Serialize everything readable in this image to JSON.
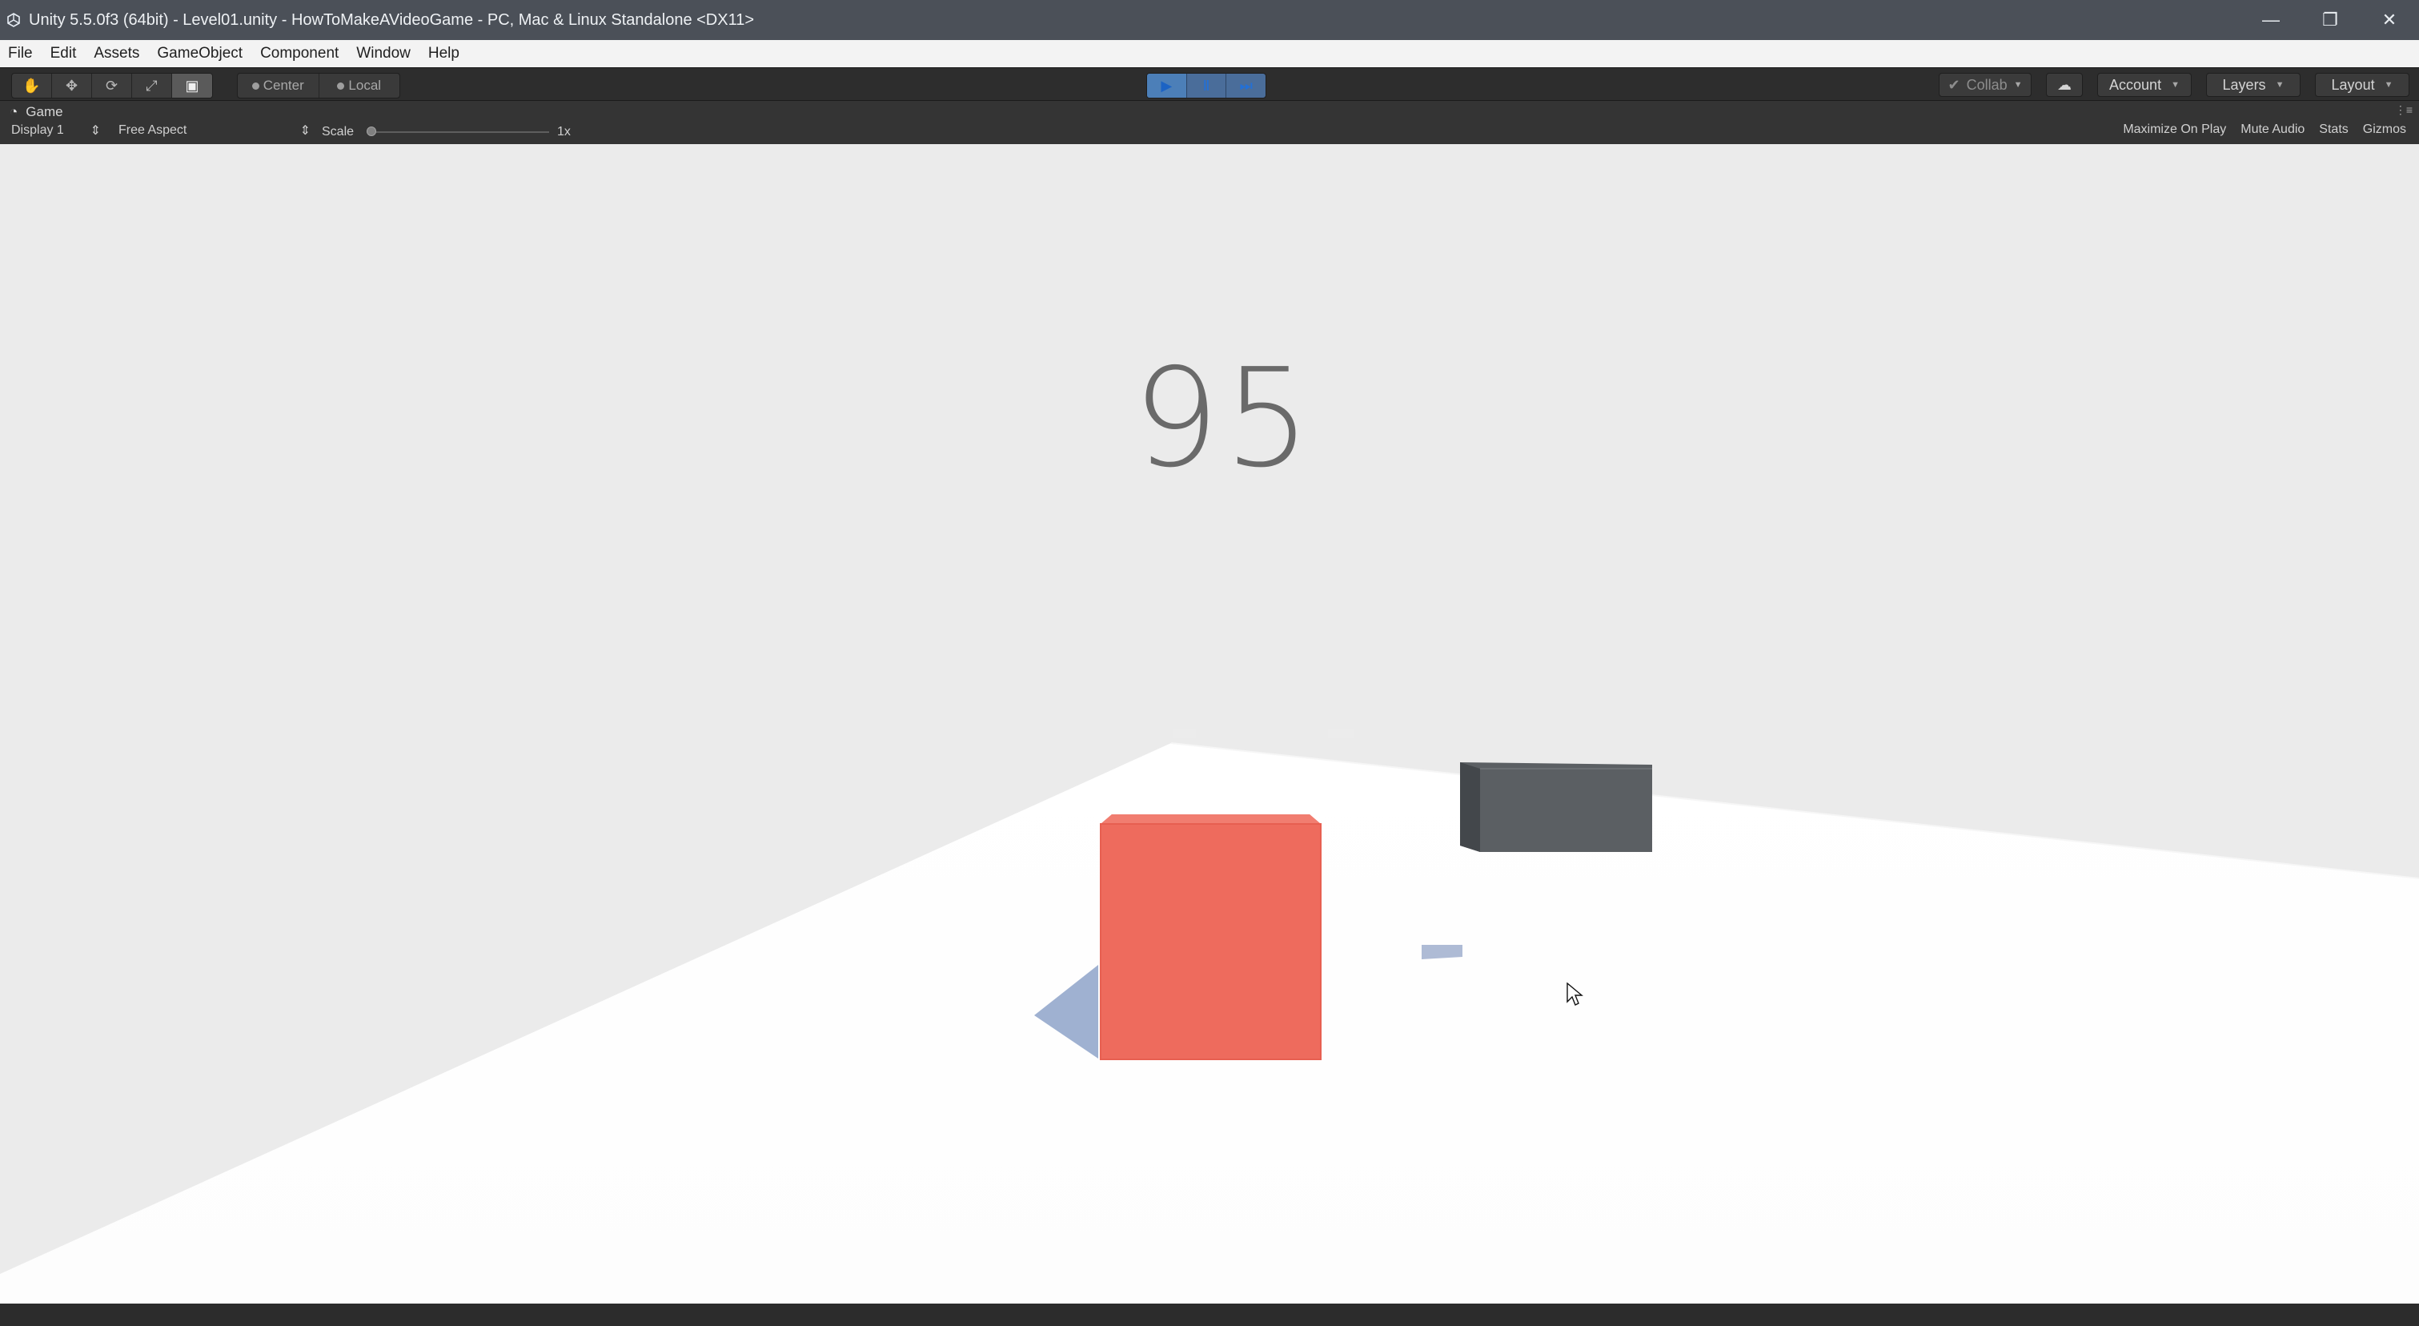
{
  "window": {
    "title": "Unity 5.5.0f3 (64bit) - Level01.unity - HowToMakeAVideoGame - PC, Mac & Linux Standalone <DX11>",
    "controls": [
      "—",
      "❐",
      "✕"
    ]
  },
  "menu": {
    "items": [
      "File",
      "Edit",
      "Assets",
      "GameObject",
      "Component",
      "Window",
      "Help"
    ]
  },
  "toolbar": {
    "pivot": {
      "center": "Center",
      "local": "Local"
    },
    "right": {
      "collab": "Collab",
      "account": "Account",
      "layers": "Layers",
      "layout": "Layout"
    }
  },
  "game": {
    "tab": "Game",
    "display": "Display 1",
    "aspect": "Free Aspect",
    "scale_label": "Scale",
    "scale_value": "1x",
    "options": [
      "Maximize On Play",
      "Mute Audio",
      "Stats",
      "Gizmos"
    ]
  },
  "scene": {
    "score": "95",
    "colors": {
      "background": "#ebebeb",
      "floor": "#ffffff",
      "player": "#ee6b5d",
      "obstacle": "#5d6063",
      "shadow": "#a8b7d2"
    }
  }
}
